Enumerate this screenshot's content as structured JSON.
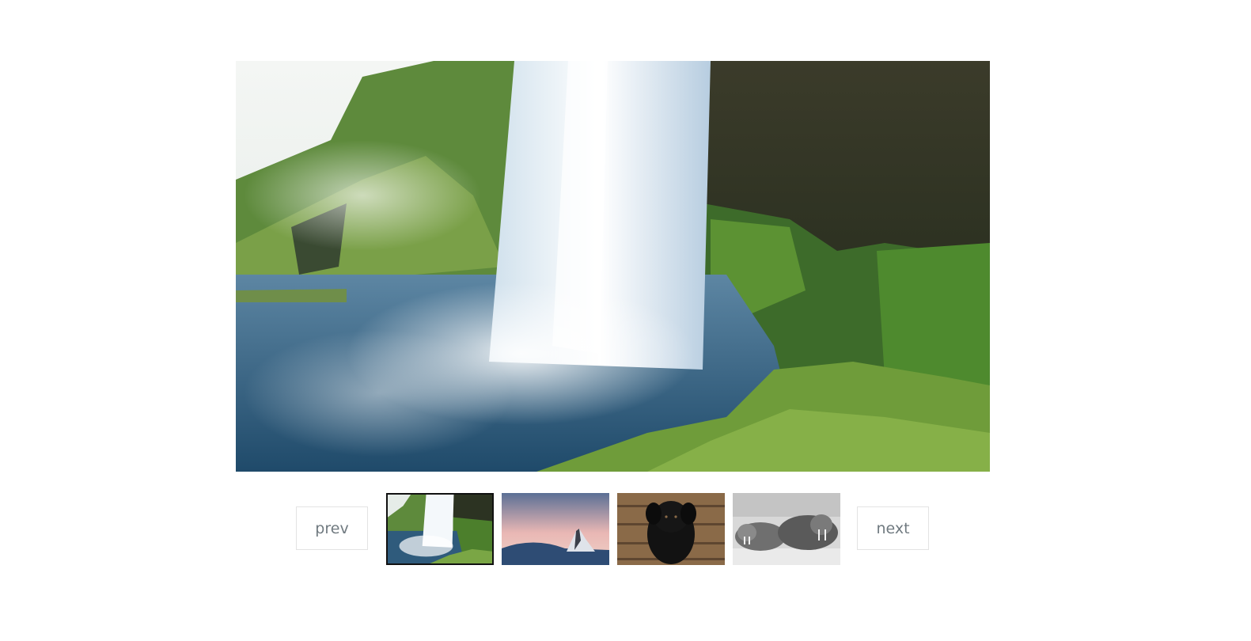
{
  "gallery": {
    "main_image_label": "waterfall",
    "prev_label": "prev",
    "next_label": "next",
    "active_index": 0,
    "thumbnails": [
      {
        "subject": "waterfall",
        "active": true
      },
      {
        "subject": "snowy-mountain",
        "active": false
      },
      {
        "subject": "black-dog",
        "active": false
      },
      {
        "subject": "walruses",
        "active": false
      }
    ]
  },
  "colors": {
    "button_text": "#707a80",
    "button_border": "#e3e3e3",
    "active_border": "#111111"
  }
}
